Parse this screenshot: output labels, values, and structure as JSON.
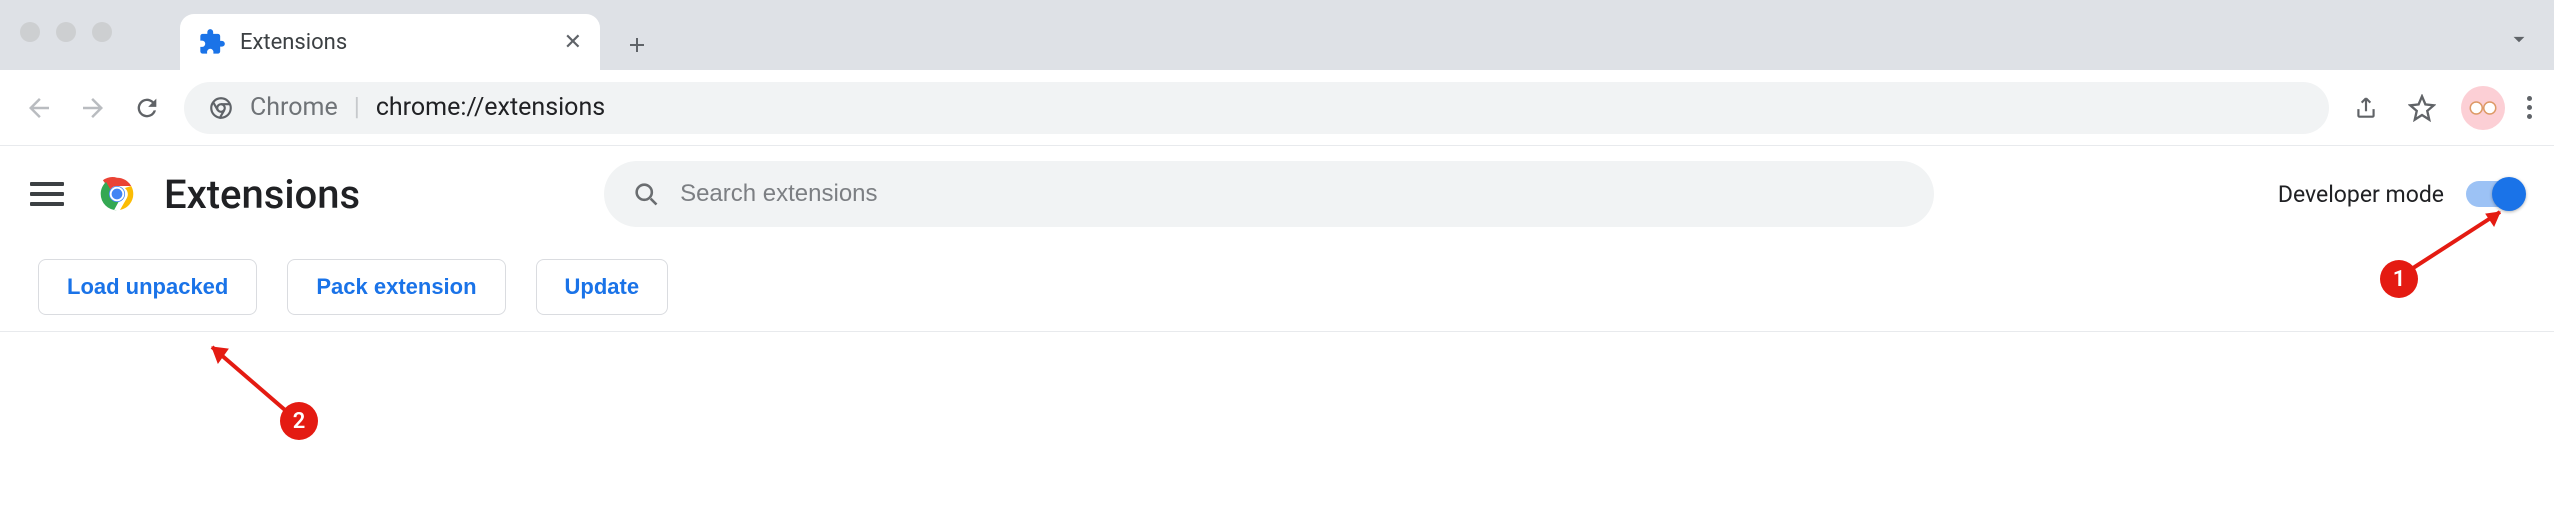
{
  "tab": {
    "title": "Extensions"
  },
  "omnibox": {
    "scheme": "Chrome",
    "path": "chrome://extensions"
  },
  "page": {
    "title": "Extensions"
  },
  "search": {
    "placeholder": "Search extensions"
  },
  "dev_mode": {
    "label": "Developer mode",
    "enabled": true
  },
  "actions": {
    "load_unpacked": "Load unpacked",
    "pack_extension": "Pack extension",
    "update": "Update"
  },
  "annotations": {
    "one": "1",
    "two": "2"
  }
}
